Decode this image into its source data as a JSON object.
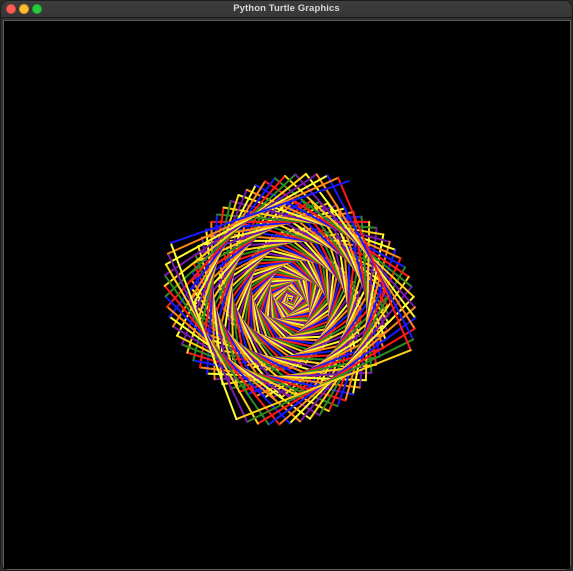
{
  "window": {
    "title": "Python Turtle Graphics"
  },
  "canvas": {
    "background_color": "#000000",
    "palette": [
      "#ff1a1a",
      "#ffd21a",
      "#ffff33",
      "#1a1aff",
      "#2e8b22",
      "#7a1aa8",
      "#ff8a1a"
    ]
  }
}
